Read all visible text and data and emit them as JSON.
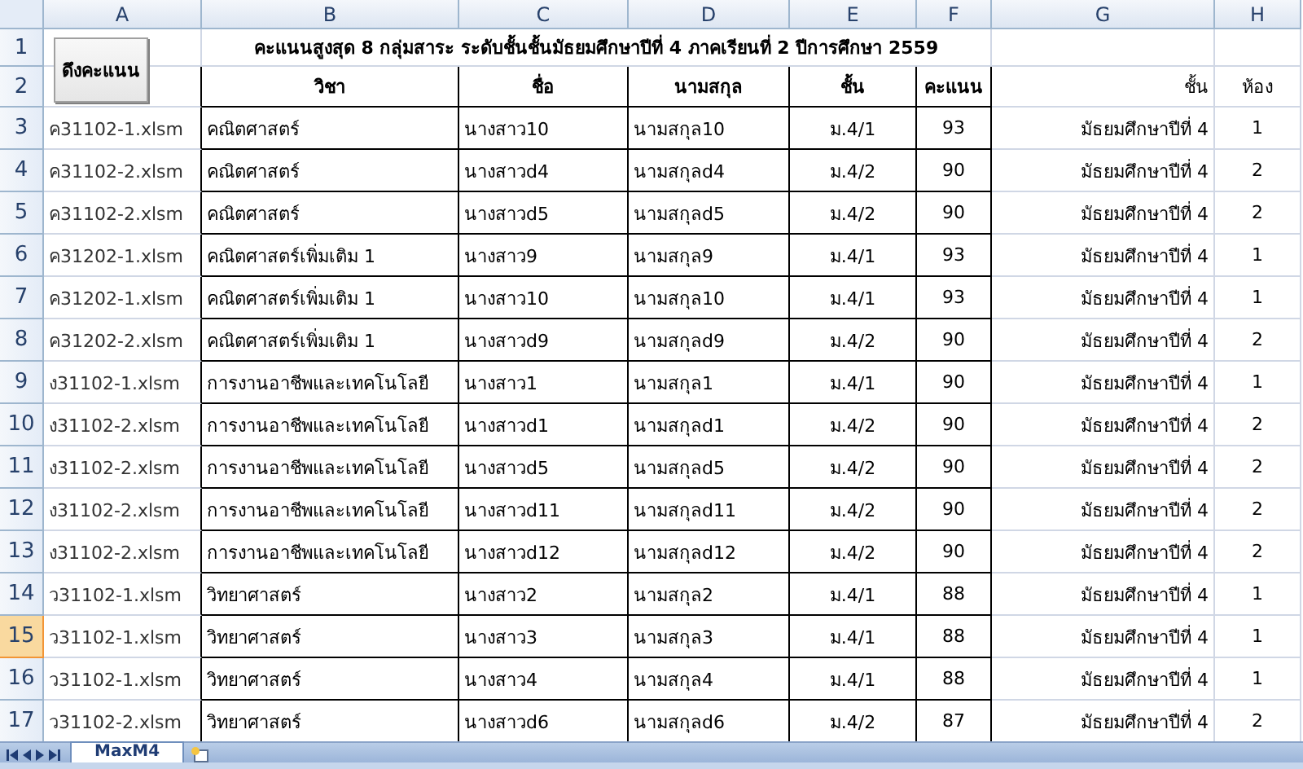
{
  "column_headers": [
    "A",
    "B",
    "C",
    "D",
    "E",
    "F",
    "G",
    "H"
  ],
  "button": "ดึงคะแนน",
  "title": "คะแนนสูงสุด 8 กลุ่มสาระ ระดับชั้นชั้นมัธยมศึกษาปีที่ 4 ภาคเรียนที่ 2 ปีการศึกษา 2559",
  "top_rows": [
    {
      "number": "1",
      "selected": false
    },
    {
      "number": "2",
      "selected": false
    }
  ],
  "table_header": [
    "วิชา",
    "ชื่อ",
    "นามสกุล",
    "ชั้น",
    "คะแนน"
  ],
  "g_header": "ชั้น",
  "h_header": "ห้อง",
  "rows": [
    {
      "number": "3",
      "file": "ค31102-1.xlsm",
      "subject": "คณิตศาสตร์",
      "first_name": "นางสาว10",
      "last_name": "นามสกุล10",
      "class": "ม.4/1",
      "score": "93",
      "grade": "มัธยมศึกษาปีที่ 4",
      "room": "1",
      "selected": false
    },
    {
      "number": "4",
      "file": "ค31102-2.xlsm",
      "subject": "คณิตศาสตร์",
      "first_name": "นางสาวd4",
      "last_name": "นามสกุลd4",
      "class": "ม.4/2",
      "score": "90",
      "grade": "มัธยมศึกษาปีที่ 4",
      "room": "2",
      "selected": false
    },
    {
      "number": "5",
      "file": "ค31102-2.xlsm",
      "subject": "คณิตศาสตร์",
      "first_name": "นางสาวd5",
      "last_name": "นามสกุลd5",
      "class": "ม.4/2",
      "score": "90",
      "grade": "มัธยมศึกษาปีที่ 4",
      "room": "2",
      "selected": false
    },
    {
      "number": "6",
      "file": "ค31202-1.xlsm",
      "subject": "คณิตศาสตร์เพิ่มเติม 1",
      "first_name": "นางสาว9",
      "last_name": "นามสกุล9",
      "class": "ม.4/1",
      "score": "93",
      "grade": "มัธยมศึกษาปีที่ 4",
      "room": "1",
      "selected": false
    },
    {
      "number": "7",
      "file": "ค31202-1.xlsm",
      "subject": "คณิตศาสตร์เพิ่มเติม 1",
      "first_name": "นางสาว10",
      "last_name": "นามสกุล10",
      "class": "ม.4/1",
      "score": "93",
      "grade": "มัธยมศึกษาปีที่ 4",
      "room": "1",
      "selected": false
    },
    {
      "number": "8",
      "file": "ค31202-2.xlsm",
      "subject": "คณิตศาสตร์เพิ่มเติม 1",
      "first_name": "นางสาวd9",
      "last_name": "นามสกุลd9",
      "class": "ม.4/2",
      "score": "90",
      "grade": "มัธยมศึกษาปีที่ 4",
      "room": "2",
      "selected": false
    },
    {
      "number": "9",
      "file": "ง31102-1.xlsm",
      "subject": "การงานอาชีพและเทคโนโลยี",
      "first_name": "นางสาว1",
      "last_name": "นามสกุล1",
      "class": "ม.4/1",
      "score": "90",
      "grade": "มัธยมศึกษาปีที่ 4",
      "room": "1",
      "selected": false
    },
    {
      "number": "10",
      "file": "ง31102-2.xlsm",
      "subject": "การงานอาชีพและเทคโนโลยี",
      "first_name": "นางสาวd1",
      "last_name": "นามสกุลd1",
      "class": "ม.4/2",
      "score": "90",
      "grade": "มัธยมศึกษาปีที่ 4",
      "room": "2",
      "selected": false
    },
    {
      "number": "11",
      "file": "ง31102-2.xlsm",
      "subject": "การงานอาชีพและเทคโนโลยี",
      "first_name": "นางสาวd5",
      "last_name": "นามสกุลd5",
      "class": "ม.4/2",
      "score": "90",
      "grade": "มัธยมศึกษาปีที่ 4",
      "room": "2",
      "selected": false
    },
    {
      "number": "12",
      "file": "ง31102-2.xlsm",
      "subject": "การงานอาชีพและเทคโนโลยี",
      "first_name": "นางสาวd11",
      "last_name": "นามสกุลd11",
      "class": "ม.4/2",
      "score": "90",
      "grade": "มัธยมศึกษาปีที่ 4",
      "room": "2",
      "selected": false
    },
    {
      "number": "13",
      "file": "ง31102-2.xlsm",
      "subject": "การงานอาชีพและเทคโนโลยี",
      "first_name": "นางสาวd12",
      "last_name": "นามสกุลd12",
      "class": "ม.4/2",
      "score": "90",
      "grade": "มัธยมศึกษาปีที่ 4",
      "room": "2",
      "selected": false
    },
    {
      "number": "14",
      "file": "ว31102-1.xlsm",
      "subject": "วิทยาศาสตร์",
      "first_name": "นางสาว2",
      "last_name": "นามสกุล2",
      "class": "ม.4/1",
      "score": "88",
      "grade": "มัธยมศึกษาปีที่ 4",
      "room": "1",
      "selected": false
    },
    {
      "number": "15",
      "file": "ว31102-1.xlsm",
      "subject": "วิทยาศาสตร์",
      "first_name": "นางสาว3",
      "last_name": "นามสกุล3",
      "class": "ม.4/1",
      "score": "88",
      "grade": "มัธยมศึกษาปีที่ 4",
      "room": "1",
      "selected": true
    },
    {
      "number": "16",
      "file": "ว31102-1.xlsm",
      "subject": "วิทยาศาสตร์",
      "first_name": "นางสาว4",
      "last_name": "นามสกุล4",
      "class": "ม.4/1",
      "score": "88",
      "grade": "มัธยมศึกษาปีที่ 4",
      "room": "1",
      "selected": false
    },
    {
      "number": "17",
      "file": "ว31102-2.xlsm",
      "subject": "วิทยาศาสตร์",
      "first_name": "นางสาวd6",
      "last_name": "นามสกุลd6",
      "class": "ม.4/2",
      "score": "87",
      "grade": "มัธยมศึกษาปีที่ 4",
      "room": "2",
      "selected": false
    }
  ],
  "sheet_tabs": [
    {
      "label": "MaxM4",
      "selected": true
    }
  ]
}
